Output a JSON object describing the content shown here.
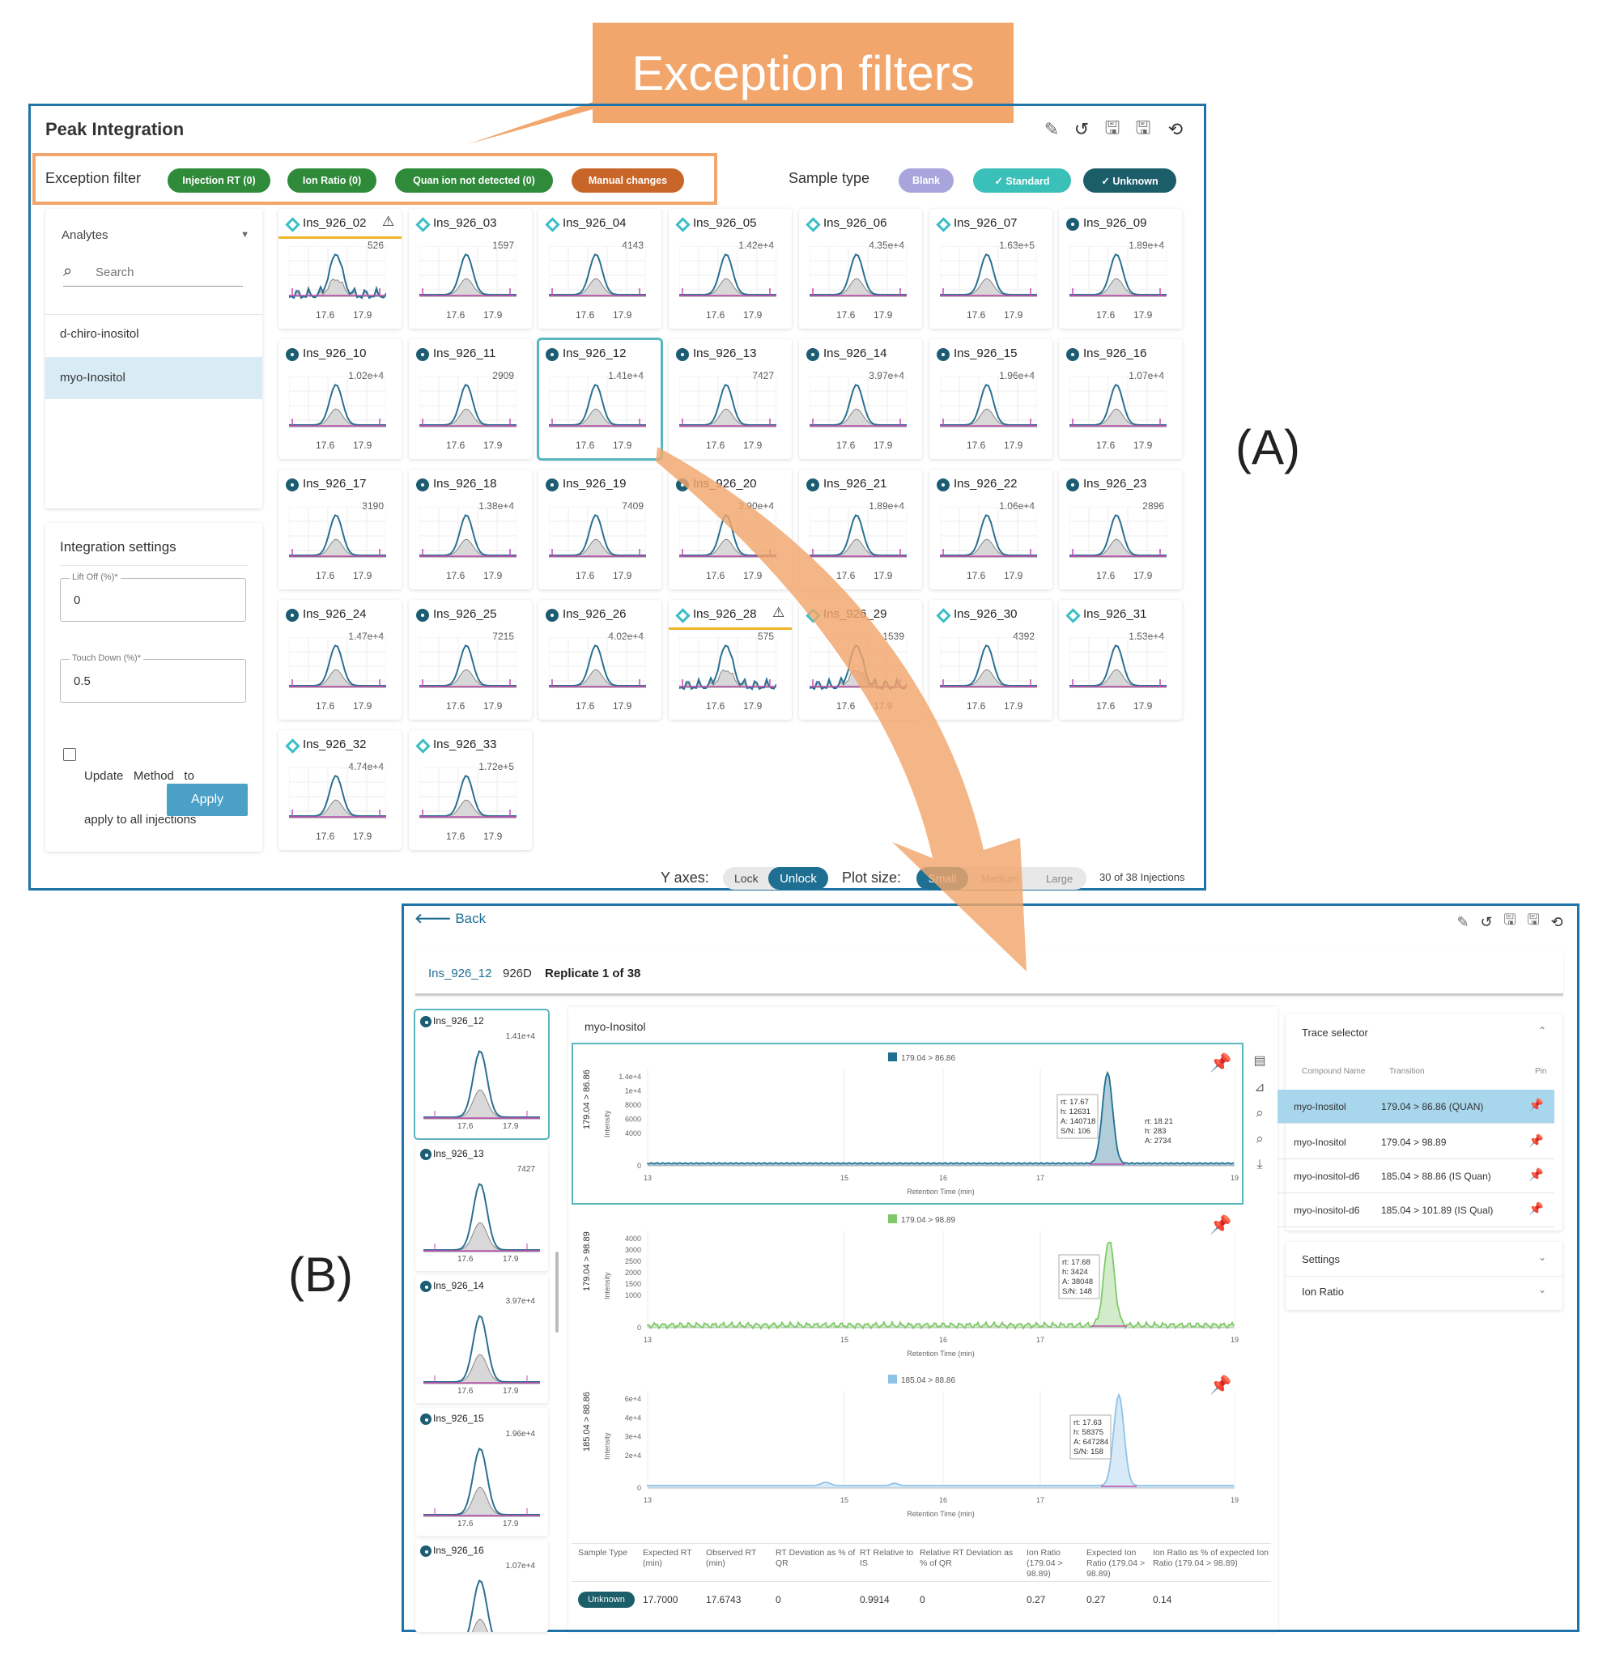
{
  "callout": {
    "text": "Exception filters",
    "color": "#f2a66b"
  },
  "label_a": "(A)",
  "label_b": "(B)",
  "panel_a": {
    "title": "Peak Integration",
    "exception_label": "Exception filter",
    "filters": [
      {
        "label": "Injection RT (0)",
        "color": "#2f8a3a"
      },
      {
        "label": "Ion Ratio (0)",
        "color": "#2f8a3a"
      },
      {
        "label": "Quan ion not detected (0)",
        "color": "#2f8a3a"
      },
      {
        "label": "Manual changes",
        "color": "#c8662a"
      }
    ],
    "sample_type_label": "Sample type",
    "sample_types": [
      {
        "label": "Blank",
        "color": "#a9a4dc"
      },
      {
        "label": "✓ Standard",
        "color": "#3bbfb9"
      },
      {
        "label": "✓ Unknown",
        "color": "#1c5d6a"
      }
    ],
    "analytes": {
      "dropdown": "Analytes",
      "search_placeholder": "Search",
      "items": [
        "d-chiro-inositol",
        "myo-Inositol"
      ]
    },
    "integration": {
      "title": "Integration settings",
      "lift_off_label": "Lift Off (%)*",
      "lift_off_value": "0",
      "touch_down_label": "Touch Down (%)*",
      "touch_down_value": "0.5",
      "update_line1": "Update   Method   to",
      "update_line2": "apply to all injections",
      "apply": "Apply"
    },
    "tick_left": "17.6",
    "tick_right": "17.9",
    "injections": [
      {
        "name": "Ins_926_02",
        "value": "526",
        "icon": "diamond",
        "flag": true
      },
      {
        "name": "Ins_926_03",
        "value": "1597",
        "icon": "diamond"
      },
      {
        "name": "Ins_926_04",
        "value": "4143",
        "icon": "diamond"
      },
      {
        "name": "Ins_926_05",
        "value": "1.42e+4",
        "icon": "diamond"
      },
      {
        "name": "Ins_926_06",
        "value": "4.35e+4",
        "icon": "diamond"
      },
      {
        "name": "Ins_926_07",
        "value": "1.63e+5",
        "icon": "diamond"
      },
      {
        "name": "Ins_926_09",
        "value": "1.89e+4",
        "icon": "dot"
      },
      {
        "name": "Ins_926_10",
        "value": "1.02e+4",
        "icon": "dot"
      },
      {
        "name": "Ins_926_11",
        "value": "2909",
        "icon": "dot"
      },
      {
        "name": "Ins_926_12",
        "value": "1.41e+4",
        "icon": "dot",
        "selected": true
      },
      {
        "name": "Ins_926_13",
        "value": "7427",
        "icon": "dot"
      },
      {
        "name": "Ins_926_14",
        "value": "3.97e+4",
        "icon": "dot"
      },
      {
        "name": "Ins_926_15",
        "value": "1.96e+4",
        "icon": "dot"
      },
      {
        "name": "Ins_926_16",
        "value": "1.07e+4",
        "icon": "dot"
      },
      {
        "name": "Ins_926_17",
        "value": "3190",
        "icon": "dot"
      },
      {
        "name": "Ins_926_18",
        "value": "1.38e+4",
        "icon": "dot"
      },
      {
        "name": "Ins_926_19",
        "value": "7409",
        "icon": "dot"
      },
      {
        "name": "Ins_926_20",
        "value": "3.90e+4",
        "icon": "dot"
      },
      {
        "name": "Ins_926_21",
        "value": "1.89e+4",
        "icon": "dot"
      },
      {
        "name": "Ins_926_22",
        "value": "1.06e+4",
        "icon": "dot"
      },
      {
        "name": "Ins_926_23",
        "value": "2896",
        "icon": "dot"
      },
      {
        "name": "Ins_926_24",
        "value": "1.47e+4",
        "icon": "dot"
      },
      {
        "name": "Ins_926_25",
        "value": "7215",
        "icon": "dot"
      },
      {
        "name": "Ins_926_26",
        "value": "4.02e+4",
        "icon": "dot"
      },
      {
        "name": "Ins_926_28",
        "value": "575",
        "icon": "diamond",
        "flag": true
      },
      {
        "name": "Ins_926_29",
        "value": "1539",
        "icon": "diamond"
      },
      {
        "name": "Ins_926_30",
        "value": "4392",
        "icon": "diamond"
      },
      {
        "name": "Ins_926_31",
        "value": "1.53e+4",
        "icon": "diamond"
      },
      {
        "name": "Ins_926_32",
        "value": "4.74e+4",
        "icon": "diamond"
      },
      {
        "name": "Ins_926_33",
        "value": "1.72e+5",
        "icon": "diamond"
      }
    ],
    "footer": {
      "y_axes": "Y axes:",
      "lock": "Lock",
      "unlock": "Unlock",
      "plot_size": "Plot size:",
      "small": "Small",
      "medium": "Medium",
      "large": "Large",
      "count": "30 of 38 Injections"
    }
  },
  "panel_b": {
    "back": "Back",
    "crumb_link": "Ins_926_12",
    "crumb_id": "926D",
    "replicate": "Replicate 1 of 38",
    "compound": "myo-Inositol",
    "mini_list": [
      {
        "name": "Ins_926_12",
        "value": "1.41e+4",
        "selected": true
      },
      {
        "name": "Ins_926_13",
        "value": "7427"
      },
      {
        "name": "Ins_926_14",
        "value": "3.97e+4"
      },
      {
        "name": "Ins_926_15",
        "value": "1.96e+4"
      },
      {
        "name": "Ins_926_16",
        "value": "1.07e+4"
      }
    ],
    "chromatograms": [
      {
        "legend": "179.04 > 86.86",
        "ylabel": "179.04 > 86.86",
        "color": "#1f6f93",
        "yticks": [
          "1.4e+4",
          "1e+4",
          "8000",
          "6000",
          "4000",
          "0"
        ],
        "annot": [
          "rt: 17.67",
          "h: 12631",
          "A: 140718",
          "S/N: 106"
        ],
        "annot2": [
          "rt: 18.21",
          "h: 283",
          "A: 2734"
        ]
      },
      {
        "legend": "179.04 > 98.89",
        "ylabel": "179.04 > 98.89",
        "color": "#7fc96a",
        "yticks": [
          "4000",
          "3000",
          "2500",
          "2000",
          "1500",
          "1000",
          "0"
        ],
        "annot": [
          "rt: 17.68",
          "h: 3424",
          "A: 38048",
          "S/N: 148"
        ]
      },
      {
        "legend": "185.04 > 88.86",
        "ylabel": "185.04 > 88.86",
        "color": "#8ec3e8",
        "yticks": [
          "6e+4",
          "4e+4",
          "3e+4",
          "2e+4",
          "0"
        ],
        "annot": [
          "rt: 17.63",
          "h: 58375",
          "A: 647284",
          "S/N: 158"
        ]
      }
    ],
    "intensity": "Intensity",
    "xticks": [
      "13",
      "15",
      "16",
      "17",
      "19"
    ],
    "xlabel": "Retention Time (min)",
    "trace_selector": {
      "title": "Trace selector",
      "headers": [
        "Compound Name",
        "Transition",
        "Pin"
      ],
      "rows": [
        {
          "compound": "myo-Inositol",
          "transition": "179.04 > 86.86 (QUAN)",
          "selected": true
        },
        {
          "compound": "myo-Inositol",
          "transition": "179.04 > 98.89"
        },
        {
          "compound": "myo-inositol-d6",
          "transition": "185.04 > 88.86 (IS Quan)"
        },
        {
          "compound": "myo-inositol-d6",
          "transition": "185.04 > 101.89 (IS Qual)"
        }
      ]
    },
    "settings": "Settings",
    "ion_ratio": "Ion Ratio",
    "table": {
      "headers": [
        "Sample Type",
        "Expected RT (min)",
        "Observed RT (min)",
        "RT Deviation as % of QR",
        "RT Relative to IS",
        "Relative RT Deviation as % of QR",
        "Ion Ratio (179.04 > 98.89)",
        "Expected Ion Ratio (179.04 > 98.89)",
        "Ion Ratio as % of expected Ion Ratio (179.04 > 98.89)"
      ],
      "row": [
        "Unknown",
        "17.7000",
        "17.6743",
        "0",
        "0.9914",
        "0",
        "0.27",
        "0.27",
        "0.14"
      ]
    }
  }
}
